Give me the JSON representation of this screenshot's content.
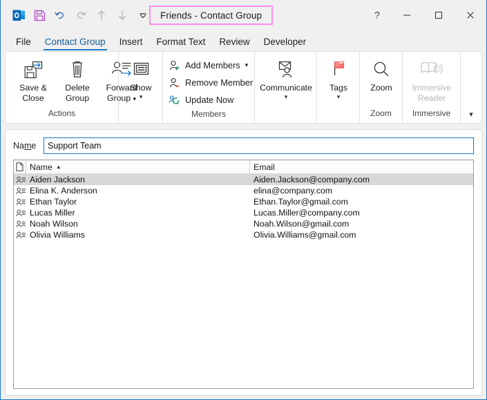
{
  "window": {
    "title": "Friends  -  Contact Group",
    "title_highlight_color": "#ff8cf0",
    "accent_color": "#1a76c7"
  },
  "quick_access": [
    {
      "name": "outlook-logo-icon",
      "label": "Outlook"
    },
    {
      "name": "save-icon",
      "label": "Save"
    },
    {
      "name": "undo-icon",
      "label": "Undo"
    },
    {
      "name": "redo-icon",
      "label": "Redo"
    },
    {
      "name": "previous-item-icon",
      "label": "Previous Item"
    },
    {
      "name": "next-item-icon",
      "label": "Next Item"
    },
    {
      "name": "customize-quick-access-toolbar-icon",
      "label": "Customize Quick Access Toolbar"
    }
  ],
  "window_controls": [
    {
      "name": "help-button",
      "glyph": "?"
    },
    {
      "name": "minimize-button",
      "glyph": "—"
    },
    {
      "name": "maximize-button",
      "glyph": "□"
    },
    {
      "name": "close-button",
      "glyph": "✕"
    }
  ],
  "tabs": [
    {
      "label": "File",
      "active": false
    },
    {
      "label": "Contact Group",
      "active": true
    },
    {
      "label": "Insert",
      "active": false
    },
    {
      "label": "Format Text",
      "active": false
    },
    {
      "label": "Review",
      "active": false
    },
    {
      "label": "Developer",
      "active": false
    }
  ],
  "ribbon": {
    "collapse_icon": "chevron-down-icon",
    "groups": [
      {
        "key": "actions",
        "label": "Actions",
        "buttons": [
          {
            "label_line1": "Save &",
            "label_line2": "Close",
            "icon": "save-and-close-icon",
            "dropdown": false,
            "disabled": false
          },
          {
            "label_line1": "Delete",
            "label_line2": "Group",
            "icon": "delete-group-icon",
            "dropdown": false,
            "disabled": false
          },
          {
            "label_line1": "Forward",
            "label_line2": "Group",
            "icon": "forward-group-icon",
            "dropdown": true,
            "disabled": false
          }
        ]
      },
      {
        "key": "show",
        "label": "",
        "buttons": [
          {
            "label_line1": "Show",
            "label_line2": "",
            "icon": "show-icon",
            "dropdown": true,
            "disabled": false
          }
        ]
      },
      {
        "key": "members",
        "label": "Members",
        "items": [
          {
            "label": "Add Members",
            "icon": "add-member-icon",
            "dropdown": true
          },
          {
            "label": "Remove Member",
            "icon": "remove-member-icon",
            "dropdown": false
          },
          {
            "label": "Update Now",
            "icon": "update-now-icon",
            "dropdown": false
          }
        ]
      },
      {
        "key": "communicate",
        "label": "",
        "buttons": [
          {
            "label_line1": "Communicate",
            "label_line2": "",
            "icon": "communicate-icon",
            "dropdown": true,
            "disabled": false
          }
        ]
      },
      {
        "key": "tags",
        "label": "",
        "buttons": [
          {
            "label_line1": "Tags",
            "label_line2": "",
            "icon": "tags-flag-icon",
            "dropdown": true,
            "disabled": false
          }
        ]
      },
      {
        "key": "zoom",
        "label": "Zoom",
        "buttons": [
          {
            "label_line1": "Zoom",
            "label_line2": "",
            "icon": "zoom-magnifier-icon",
            "dropdown": false,
            "disabled": false
          }
        ]
      },
      {
        "key": "immersive",
        "label": "Immersive",
        "buttons": [
          {
            "label_line1": "Immersive",
            "label_line2": "Reader",
            "icon": "immersive-reader-icon",
            "dropdown": false,
            "disabled": true
          }
        ]
      }
    ]
  },
  "form": {
    "name_label_pre": "Na",
    "name_label_accel": "m",
    "name_label_post": "e",
    "name_value": "Support Team",
    "name_placeholder": ""
  },
  "members_list": {
    "columns": [
      {
        "key": "icon",
        "label": ""
      },
      {
        "key": "name",
        "label": "Name",
        "sorted": "asc"
      },
      {
        "key": "email",
        "label": "Email",
        "sorted": ""
      }
    ],
    "rows": [
      {
        "name": "Aiden Jackson",
        "email": "Aiden.Jackson@company.com",
        "selected": true
      },
      {
        "name": "Elina K. Anderson",
        "email": "elina@company.com",
        "selected": false
      },
      {
        "name": "Ethan Taylor",
        "email": "Ethan.Taylor@gmail.com",
        "selected": false
      },
      {
        "name": "Lucas Miller",
        "email": "Lucas.Miller@company.com",
        "selected": false
      },
      {
        "name": "Noah Wilson",
        "email": "Noah.Wilson@gmail.com",
        "selected": false
      },
      {
        "name": "Olivia Williams",
        "email": "Olivia.Williams@gmail.com",
        "selected": false
      }
    ]
  }
}
